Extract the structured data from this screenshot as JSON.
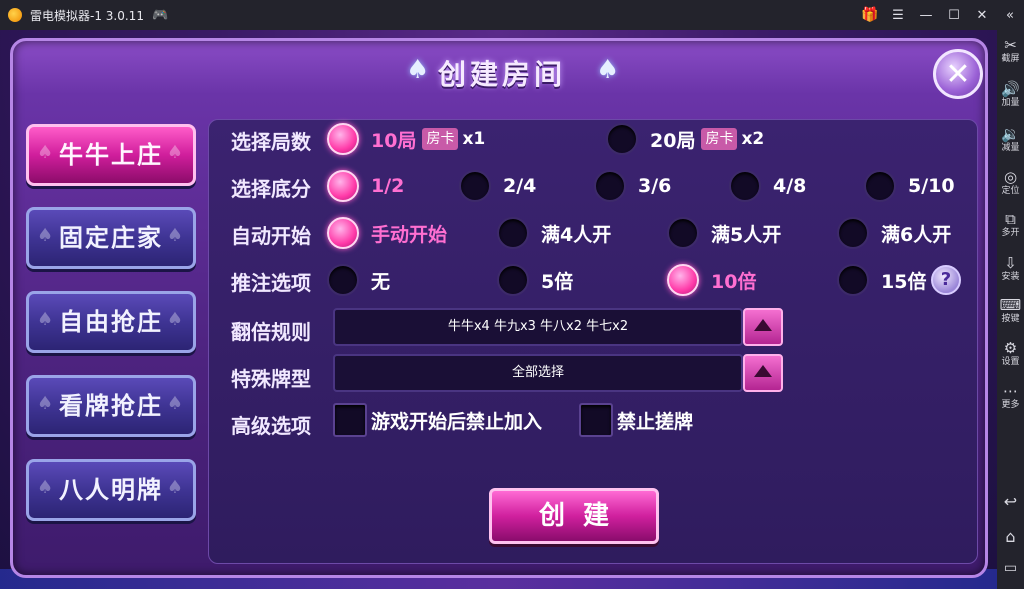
{
  "window": {
    "title": "雷电模拟器-1 3.0.11",
    "controls": [
      "gift-icon",
      "menu-icon",
      "minimize-icon",
      "maximize-icon",
      "close-icon",
      "collapse-icon"
    ]
  },
  "tools": [
    {
      "icon": "✂",
      "label": "截屏"
    },
    {
      "icon": "🔊",
      "label": "加量"
    },
    {
      "icon": "🔉",
      "label": "减量"
    },
    {
      "icon": "◎",
      "label": "定位"
    },
    {
      "icon": "⧉",
      "label": "多开"
    },
    {
      "icon": "⇩",
      "label": "安装"
    },
    {
      "icon": "⌨",
      "label": "按键"
    },
    {
      "icon": "⚙",
      "label": "设置"
    },
    {
      "icon": "⋯",
      "label": "更多"
    }
  ],
  "nav": [
    "back-icon",
    "home-icon",
    "recent-apps-icon"
  ],
  "dialog": {
    "title": "创建房间",
    "close_symbol": "✕",
    "modes": [
      {
        "label": "牛牛上庄",
        "active": true
      },
      {
        "label": "固定庄家",
        "active": false
      },
      {
        "label": "自由抢庄",
        "active": false
      },
      {
        "label": "看牌抢庄",
        "active": false
      },
      {
        "label": "八人明牌",
        "active": false
      }
    ],
    "rounds": {
      "label": "选择局数",
      "options": [
        {
          "text": "10局",
          "badge": "房卡",
          "mult": "x1",
          "selected": true
        },
        {
          "text": "20局",
          "badge": "房卡",
          "mult": "x2",
          "selected": false
        }
      ]
    },
    "base_score": {
      "label": "选择底分",
      "options": [
        {
          "text": "1/2",
          "selected": true
        },
        {
          "text": "2/4",
          "selected": false
        },
        {
          "text": "3/6",
          "selected": false
        },
        {
          "text": "4/8",
          "selected": false
        },
        {
          "text": "5/10",
          "selected": false
        }
      ]
    },
    "auto_start": {
      "label": "自动开始",
      "options": [
        {
          "text": "手动开始",
          "selected": true
        },
        {
          "text": "满4人开",
          "selected": false
        },
        {
          "text": "满5人开",
          "selected": false
        },
        {
          "text": "满6人开",
          "selected": false
        }
      ]
    },
    "bet_options": {
      "label": "推注选项",
      "options": [
        {
          "text": "无",
          "selected": false
        },
        {
          "text": "5倍",
          "selected": false
        },
        {
          "text": "10倍",
          "selected": true
        },
        {
          "text": "15倍",
          "selected": false
        }
      ],
      "help_symbol": "?"
    },
    "double_rules": {
      "label": "翻倍规则",
      "value": "牛牛x4 牛九x3 牛八x2 牛七x2"
    },
    "special_cards": {
      "label": "特殊牌型",
      "value": "全部选择"
    },
    "advanced": {
      "label": "高级选项",
      "checks": [
        {
          "text": "游戏开始后禁止加入",
          "checked": false
        },
        {
          "text": "禁止搓牌",
          "checked": false
        }
      ]
    },
    "create_label": "创建"
  }
}
